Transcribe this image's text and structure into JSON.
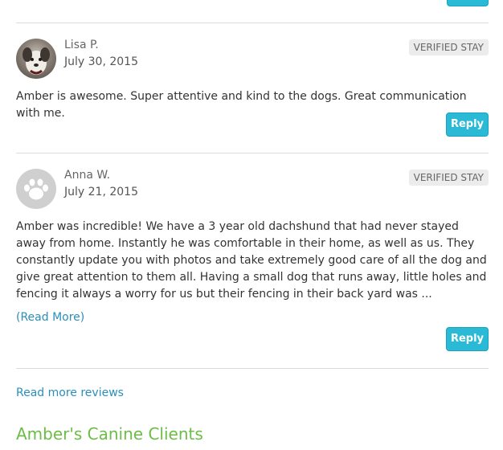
{
  "reviews": [
    {
      "name": "Lisa P.",
      "date": "July 30, 2015",
      "badge": "VERIFIED STAY",
      "text": "Amber is awesome. Super attentive and kind to the dogs. Great communication with me.",
      "reply_label": "Reply",
      "avatar_icon": "dog-photo"
    },
    {
      "name": "Anna W.",
      "date": "July 21, 2015",
      "badge": "VERIFIED STAY",
      "text": "Amber was incredible! We have a 3 year old dachshund that had never stayed away from home. Instantly he was comfortable in their home, as well as us. They constantly update you with photos and take extremely good care of all the dog and give great attention to them all. Having a small dog that runs away, little holes and fencing it always a worry for us but their fencing in their back yard was ...",
      "read_more": "(Read More)",
      "reply_label": "Reply",
      "avatar_icon": "paw-icon"
    }
  ],
  "read_more_reviews": "Read more reviews",
  "section_title": "Amber's Canine Clients",
  "colors": {
    "accent": "#2bbad6",
    "link": "#2a8fb8",
    "section_title": "#6cbd45",
    "badge_bg": "#ececec"
  }
}
